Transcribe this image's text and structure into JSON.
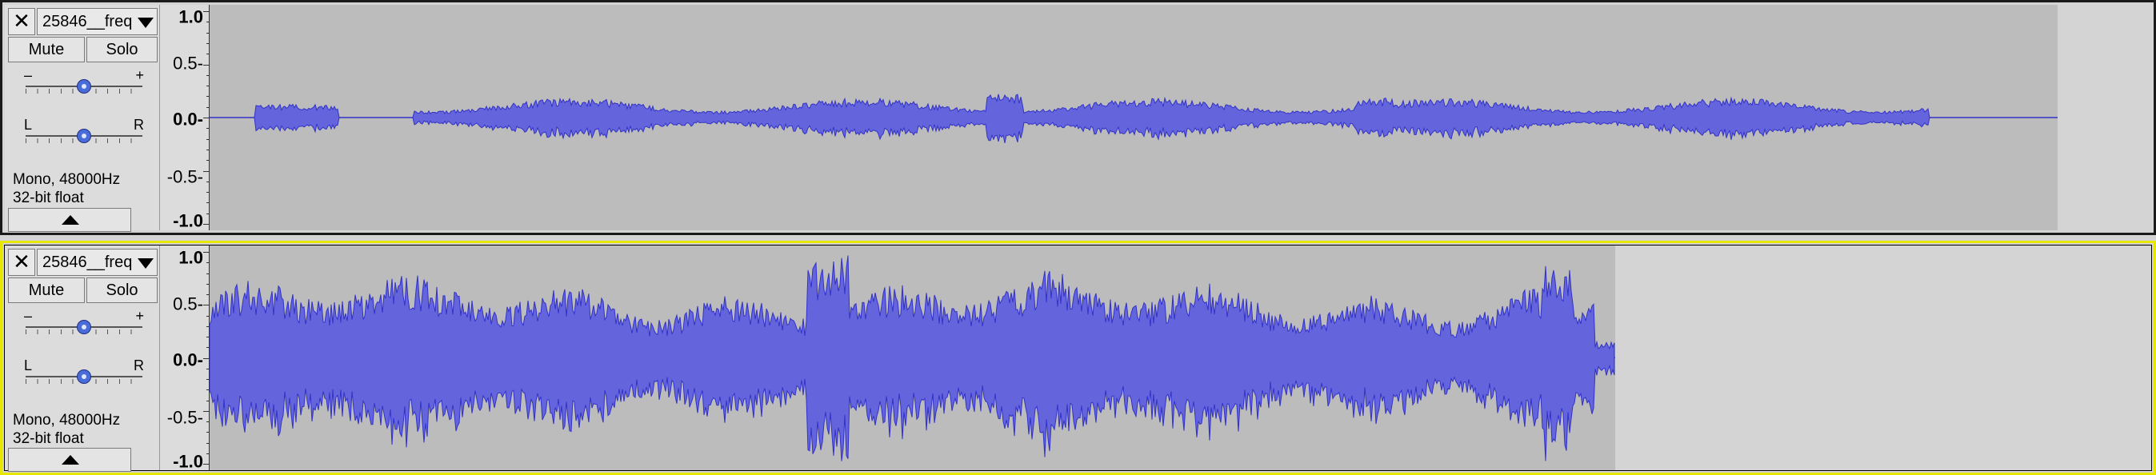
{
  "tracks": [
    {
      "close_symbol": "✕",
      "name": "25846__freq",
      "mute_label": "Mute",
      "solo_label": "Solo",
      "gain_minus": "–",
      "gain_plus": "+",
      "gain_level": 0.5,
      "pan_left": "L",
      "pan_right": "R",
      "pan_level": 0.5,
      "format_line1": "Mono, 48000Hz",
      "format_line2": "32-bit float",
      "scale": [
        "1.0",
        "0.5-",
        "0.0-",
        "-0.5-",
        "-1.0"
      ],
      "colors": {
        "waveform": "#6464dc",
        "waveform_edge": "#3232c8",
        "background": "#bcbcbc"
      }
    },
    {
      "close_symbol": "✕",
      "name": "25846__freq",
      "mute_label": "Mute",
      "solo_label": "Solo",
      "gain_minus": "–",
      "gain_plus": "+",
      "gain_level": 0.5,
      "pan_left": "L",
      "pan_right": "R",
      "pan_level": 0.5,
      "format_line1": "Mono, 48000Hz",
      "format_line2": "32-bit float",
      "scale": [
        "1.0",
        "0.5-",
        "0.0-",
        "-0.5-",
        "-1.0"
      ],
      "colors": {
        "waveform": "#6464dc",
        "waveform_edge": "#3232c8",
        "background": "#bcbcbc"
      }
    }
  ]
}
